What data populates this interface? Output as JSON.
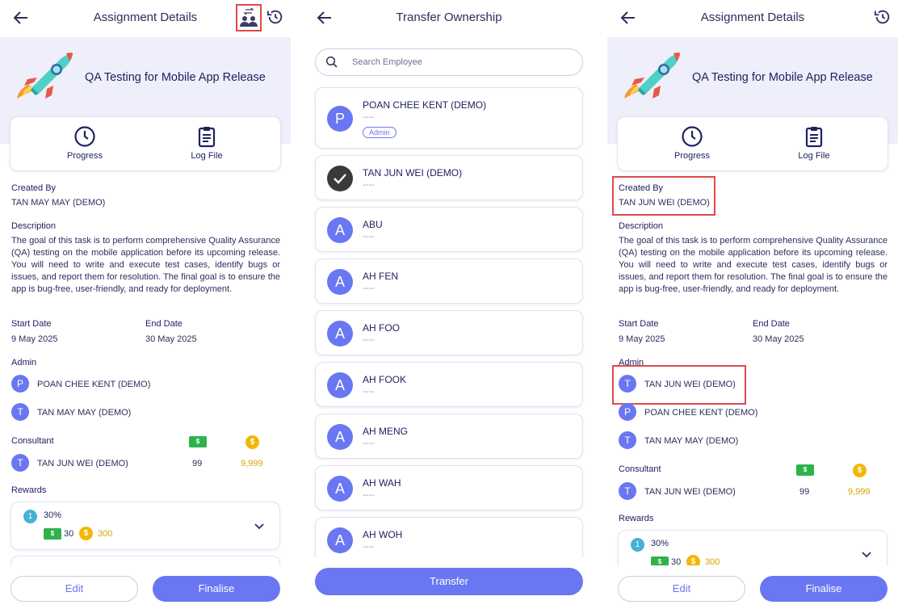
{
  "details_left": {
    "title": "Assignment Details",
    "task_title": "QA Testing for Mobile App Release",
    "progress_label": "Progress",
    "logfile_label": "Log File",
    "created_by_label": "Created By",
    "created_by": "TAN MAY MAY (DEMO)",
    "description_label": "Description",
    "description": "The goal of this task is to perform comprehensive Quality Assurance (QA) testing on the mobile application before its upcoming release. You will need to write and execute test cases, identify bugs or issues, and report them for resolution. The final goal is to ensure the app is bug-free, user-friendly, and ready for deployment.",
    "start_label": "Start Date",
    "start_date": "9 May 2025",
    "end_label": "End Date",
    "end_date": "30 May 2025",
    "admin_label": "Admin",
    "admins": [
      {
        "initial": "P",
        "name": "POAN CHEE KENT (DEMO)"
      },
      {
        "initial": "T",
        "name": "TAN MAY MAY (DEMO)"
      }
    ],
    "consultant_label": "Consultant",
    "consultant": {
      "initial": "T",
      "name": "TAN JUN WEI (DEMO)",
      "cash": "99",
      "coins": "9,999"
    },
    "rewards_label": "Rewards",
    "reward": {
      "rank": "1",
      "percent": "30%",
      "cash": "30",
      "coins": "300"
    },
    "edit_label": "Edit",
    "finalise_label": "Finalise"
  },
  "transfer": {
    "title": "Transfer Ownership",
    "search_placeholder": "Search Employee",
    "employees": [
      {
        "initial": "P",
        "name": "POAN CHEE KENT (DEMO)",
        "sub": "----",
        "badge": "Admin"
      },
      {
        "initial": "",
        "name": "TAN JUN WEI (DEMO)",
        "sub": "----",
        "selected": true
      },
      {
        "initial": "A",
        "name": "ABU",
        "sub": "----"
      },
      {
        "initial": "A",
        "name": "AH FEN",
        "sub": "----"
      },
      {
        "initial": "A",
        "name": "AH FOO",
        "sub": "----"
      },
      {
        "initial": "A",
        "name": "AH FOOK",
        "sub": "----"
      },
      {
        "initial": "A",
        "name": "AH MENG",
        "sub": "----"
      },
      {
        "initial": "A",
        "name": "AH WAH",
        "sub": "----"
      },
      {
        "initial": "A",
        "name": "AH WOH",
        "sub": "----"
      }
    ],
    "transfer_label": "Transfer"
  },
  "details_right": {
    "title": "Assignment Details",
    "task_title": "QA Testing for Mobile App Release",
    "progress_label": "Progress",
    "logfile_label": "Log File",
    "created_by_label": "Created By",
    "created_by": "TAN JUN WEI (DEMO)",
    "description_label": "Description",
    "description": "The goal of this task is to perform comprehensive Quality Assurance (QA) testing on the mobile application before its upcoming release. You will need to write and execute test cases, identify bugs or issues, and report them for resolution. The final goal is to ensure the app is bug-free, user-friendly, and ready for deployment.",
    "start_label": "Start Date",
    "start_date": "9 May 2025",
    "end_label": "End Date",
    "end_date": "30 May 2025",
    "admin_label": "Admin",
    "admins": [
      {
        "initial": "T",
        "name": "TAN JUN WEI (DEMO)"
      },
      {
        "initial": "P",
        "name": "POAN CHEE KENT (DEMO)"
      },
      {
        "initial": "T",
        "name": "TAN MAY MAY (DEMO)"
      }
    ],
    "consultant_label": "Consultant",
    "consultant": {
      "initial": "T",
      "name": "TAN JUN WEI (DEMO)",
      "cash": "99",
      "coins": "9,999"
    },
    "rewards_label": "Rewards",
    "reward": {
      "rank": "1",
      "percent": "30%",
      "cash": "30",
      "coins": "300"
    },
    "edit_label": "Edit",
    "finalise_label": "Finalise"
  },
  "icons": {
    "back": "arrow-left-icon",
    "history": "history-icon",
    "transfer": "transfer-users-icon",
    "progress": "clock-icon",
    "logfile": "clipboard-icon",
    "search": "search-icon",
    "chevron": "chevron-down-icon",
    "cash": "cash-icon",
    "coin": "coin-icon",
    "check": "check-icon"
  },
  "colors": {
    "accent": "#6a77f2",
    "hero_bg": "#eeeffb",
    "highlight": "#e0494b",
    "cash": "#2eb24c",
    "coin": "#f2b705"
  }
}
